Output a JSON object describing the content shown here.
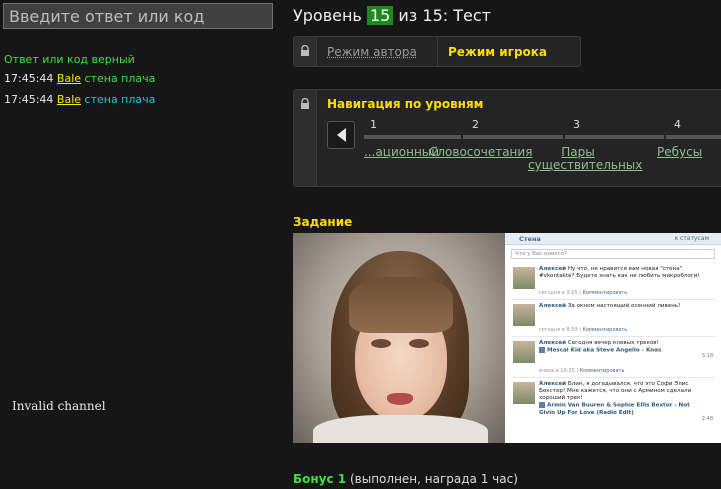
{
  "answer_input": {
    "placeholder": "Введите ответ или код"
  },
  "status_text": "Ответ или код верный",
  "log": [
    {
      "time": "17:45:44",
      "user": "Bale",
      "text": "стена плача"
    },
    {
      "time": "17:45:44",
      "user": "Bale",
      "text": "стена плача"
    }
  ],
  "channel_message": "Invalid channel",
  "level": {
    "prefix": "Уровень",
    "number": "15",
    "of": "из 15: Тест"
  },
  "modes": {
    "author": "Режим автора",
    "player": "Режим игрока"
  },
  "navigation": {
    "title": "Навигация по уровням",
    "items": [
      {
        "num": "1",
        "label": "...ационный"
      },
      {
        "num": "2",
        "label": "Словосочетания"
      },
      {
        "num": "3",
        "label": "Пары существительных"
      },
      {
        "num": "4",
        "label": "Ребусы"
      }
    ]
  },
  "task": {
    "title": "Задание",
    "wall": {
      "header": "Стена",
      "header_link": "к статусам",
      "input_placeholder": "Что у Вас нового?",
      "posts": [
        {
          "author": "Алексей",
          "text": "Ну что, не нравится вам новая \"стена\" #vkontakte? Будете знать как не любить микроблоги!",
          "meta": "сегодня в 9:15",
          "action": "Комментировать",
          "audio": "",
          "duration": ""
        },
        {
          "author": "Алексей",
          "text": "За окном настоящий осенний ливень!",
          "meta": "сегодня в 8:59",
          "action": "Комментировать",
          "audio": "",
          "duration": ""
        },
        {
          "author": "Алексей",
          "text": "Сегодня вечер клевых треков!",
          "meta": "вчера в 19:35",
          "action": "Комментировать",
          "audio": "Mescal Kid aka Steve Angello - Knas",
          "duration": "3:18"
        },
        {
          "author": "Алексей",
          "text": "Блин, я догадывался, что это Софи Элис Бекстер! Мне кажется, что они с Армином сделали хороший трек!",
          "meta": "",
          "action": "",
          "audio": "Armin Van Buuren & Sophie Ellis Bextor - Not Givin Up For Love (Radio Edit)",
          "duration": "2:48"
        }
      ]
    }
  },
  "bonus": {
    "label": "Бонус 1",
    "text": "(выполнен, награда 1 час)"
  }
}
